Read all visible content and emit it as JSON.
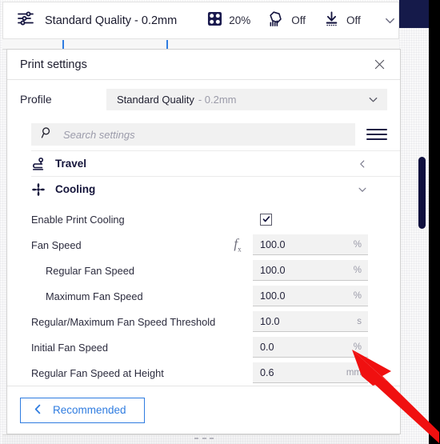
{
  "topbar": {
    "settings_icon": "sliders-icon",
    "profile_label": "Standard Quality - 0.2mm",
    "stats": [
      {
        "icon": "infill-icon",
        "value": "20%"
      },
      {
        "icon": "support-icon",
        "value": "Off"
      },
      {
        "icon": "adhesion-icon",
        "value": "Off"
      }
    ],
    "expand_icon": "chevron-down-icon"
  },
  "panel": {
    "title": "Print settings",
    "close_icon": "close-icon",
    "profile": {
      "label": "Profile",
      "value_name": "Standard Quality",
      "value_sub": "- 0.2mm",
      "dropdown_icon": "chevron-down-icon"
    },
    "search": {
      "icon": "search-icon",
      "placeholder": "Search settings",
      "menu_icon": "hamburger-menu-icon"
    },
    "categories": [
      {
        "icon": "travel-icon",
        "label": "Travel",
        "state": "collapsed",
        "chevron": "chevron-left-icon"
      },
      {
        "icon": "cooling-fan-icon",
        "label": "Cooling",
        "state": "expanded",
        "chevron": "chevron-down-icon"
      }
    ],
    "settings": [
      {
        "label": "Enable Print Cooling",
        "type": "checkbox",
        "checked": true,
        "indent": false,
        "has_fx": false
      },
      {
        "label": "Fan Speed",
        "type": "number",
        "value": "100.0",
        "unit": "%",
        "indent": false,
        "has_fx": true,
        "fx_icon": "function-fx-icon"
      },
      {
        "label": "Regular Fan Speed",
        "type": "number",
        "value": "100.0",
        "unit": "%",
        "indent": true,
        "has_fx": false
      },
      {
        "label": "Maximum Fan Speed",
        "type": "number",
        "value": "100.0",
        "unit": "%",
        "indent": true,
        "has_fx": false
      },
      {
        "label": "Regular/Maximum Fan Speed Threshold",
        "type": "number",
        "value": "10.0",
        "unit": "s",
        "indent": false,
        "has_fx": false
      },
      {
        "label": "Initial Fan Speed",
        "type": "number",
        "value": "0.0",
        "unit": "%",
        "indent": false,
        "has_fx": false
      },
      {
        "label": "Regular Fan Speed at Height",
        "type": "number",
        "value": "0.6",
        "unit": "mm",
        "indent": false,
        "has_fx": false
      }
    ],
    "footer": {
      "recommended_label": "Recommended",
      "recommended_icon": "chevron-left-icon"
    }
  },
  "colors": {
    "accent_blue": "#2f7ce0",
    "navy": "#10103f",
    "annotation_red": "#f01010",
    "field_bg": "#f2f2f2"
  },
  "annotation": {
    "arrow_icon": "red-arrow-pointer",
    "points_at": "Initial Fan Speed"
  }
}
